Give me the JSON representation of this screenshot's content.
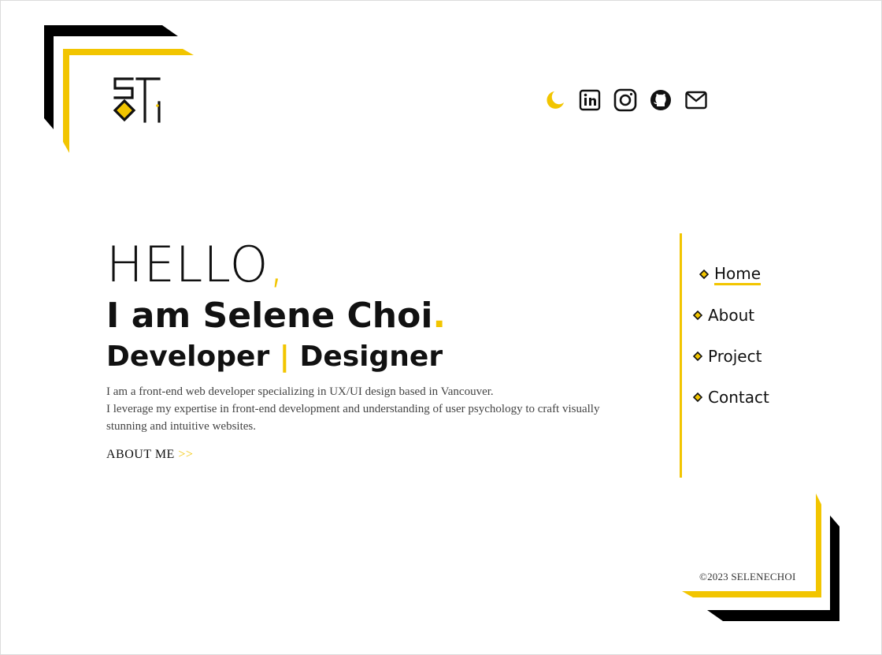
{
  "brand": {
    "logo_name": "SC monogram",
    "accent": "#f2c500",
    "ink": "#111111"
  },
  "header_icons": [
    {
      "name": "moon-icon"
    },
    {
      "name": "linkedin-icon"
    },
    {
      "name": "instagram-icon"
    },
    {
      "name": "github-icon"
    },
    {
      "name": "mail-icon"
    }
  ],
  "hero": {
    "hello": "HELLO",
    "hello_punct": ",",
    "intro": "I am Selene Choi",
    "intro_punct": ".",
    "role_a": "Developer",
    "role_sep": "|",
    "role_b": "Designer",
    "desc_line1": "I am a front-end web developer specializing in UX/UI design based in Vancouver.",
    "desc_line2": "I leverage my expertise in front-end development and understanding of user psychology to craft visually stunning and intuitive websites.",
    "cta_label": "ABOUT ME",
    "cta_arrows": ">>"
  },
  "nav": {
    "items": [
      {
        "label": "Home",
        "active": true
      },
      {
        "label": "About",
        "active": false
      },
      {
        "label": "Project",
        "active": false
      },
      {
        "label": "Contact",
        "active": false
      }
    ]
  },
  "footer": {
    "copyright": "©2023 SELENECHOI"
  }
}
